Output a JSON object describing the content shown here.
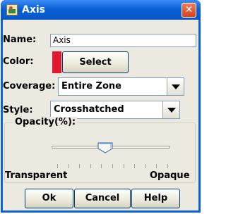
{
  "window": {
    "title": "Axis",
    "close_glyph": "✕"
  },
  "form": {
    "name_label": "Name:",
    "name_value": "Axis",
    "color_label": "Color:",
    "color_value": "#e01830",
    "select_label": "Select",
    "coverage_label": "Coverage:",
    "coverage_value": "Entire Zone",
    "style_label": "Style:",
    "style_value": "Crosshatched"
  },
  "opacity": {
    "title": "Opacity(%):",
    "value_fraction": 0.45,
    "min_label": "Transparent",
    "max_label": "Opaque",
    "tick_count": 11
  },
  "buttons": {
    "ok": "Ok",
    "cancel": "Cancel",
    "help": "Help"
  },
  "icons": {
    "app": "app-icon",
    "close": "close-icon",
    "dropdown": "chevron-down-icon"
  },
  "colors": {
    "title_bar": "#0a5fd6",
    "close_button": "#d6421e",
    "background": "#ebe9e0"
  }
}
